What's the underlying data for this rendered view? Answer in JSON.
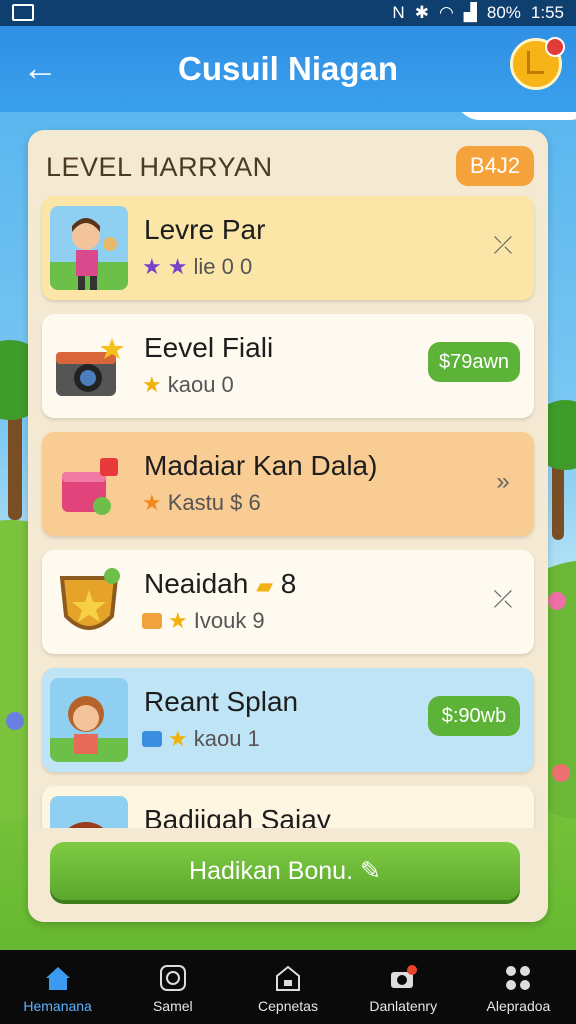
{
  "status_bar": {
    "battery": "80%",
    "time": "1:55"
  },
  "app_bar": {
    "title": "Cusuil Niagan",
    "back_icon": "back-arrow-icon",
    "coin_icon": "coin-icon"
  },
  "panel": {
    "header": "LEVEL HARRYAN",
    "badge": "B4J2",
    "items": [
      {
        "name": "Levre Par",
        "sub_text": "lie 0 0",
        "action": "chevron",
        "bg": "#fbe6a8",
        "thumb_bg": "#8fd0f2",
        "star_class": "purple"
      },
      {
        "name": "Eevel Fiali",
        "sub_text": "kaou 0",
        "action": "price",
        "price": "$79awn",
        "bg": "#fffaf0",
        "thumb_bg": "#fffaf0",
        "star_class": "gold"
      },
      {
        "name": "Madaiar Kan Dala)",
        "sub_text": "Kastu $ 6",
        "action": "chevron",
        "bg": "#f8cc93",
        "thumb_bg": "#f8cc93",
        "star_class": "orange"
      },
      {
        "name": "Neaidah",
        "name_suffix": "8",
        "sub_text": "Ivouk 9",
        "action": "chevron",
        "bg": "#fffaf0",
        "thumb_bg": "#fffaf0",
        "star_class": "gold"
      },
      {
        "name": "Reant Splan",
        "sub_text": "kaou 1",
        "action": "price",
        "price": "$:90wb",
        "bg": "#bfe4f5",
        "thumb_bg": "#8fd0f2",
        "star_class": "gold"
      },
      {
        "name": "Badiigah Saiay",
        "sub_text": "",
        "action": "chevron",
        "bg": "#fff6e2",
        "thumb_bg": "#8fd0f2",
        "star_class": "gold"
      }
    ],
    "cta_label": "Hadikan Bonu."
  },
  "bottom_nav": [
    {
      "label": "Hemanana",
      "icon": "home-icon",
      "active": true
    },
    {
      "label": "Samel",
      "icon": "clock-badge-icon",
      "active": false
    },
    {
      "label": "Cepnetas",
      "icon": "shop-icon",
      "active": false
    },
    {
      "label": "Danlatenry",
      "icon": "camera-notification-icon",
      "active": false
    },
    {
      "label": "Alepradoa",
      "icon": "grid-icon",
      "active": false
    }
  ],
  "colors": {
    "app_bar": "#2f8fe4",
    "accent_green": "#5cb338",
    "badge_orange": "#f5a23a",
    "nav_active": "#5db2ff"
  }
}
